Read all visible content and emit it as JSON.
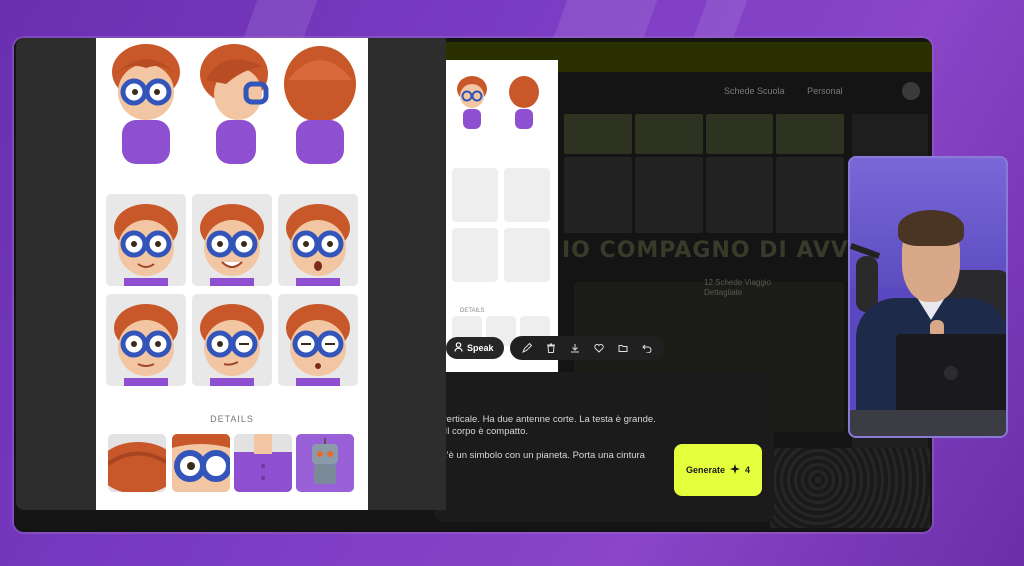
{
  "background_app": {
    "nav_items": [
      "Schede Scuola",
      "Personal"
    ],
    "heading": "IO COMPAGNO DI AVVENTUR",
    "caption_lines": [
      "12 Schede Viaggio",
      "Dettagliate"
    ]
  },
  "character_sheet": {
    "details_label": "DETAILS",
    "colors": {
      "hair": "#c8582a",
      "shirt": "#8e4fd0",
      "glasses": "#3354b8",
      "skin": "#f2c6a2"
    }
  },
  "mid_panel": {
    "details_label": "DETAILS"
  },
  "toolbar": {
    "speak_label": "Speak",
    "icons": [
      "user-icon",
      "pencil-icon",
      "trash-icon",
      "download-icon",
      "heart-icon",
      "folder-icon",
      "undo-icon"
    ]
  },
  "prompt": {
    "line1": "n verticale. Ha due antenne corte. La testa è grande.",
    "line2": "a. Il corpo è compatto.",
    "line3": "o c'è un simbolo con un pianeta. Porta una cintura"
  },
  "generate": {
    "label": "Generate",
    "count": "4",
    "accent": "#e4ff3c"
  }
}
